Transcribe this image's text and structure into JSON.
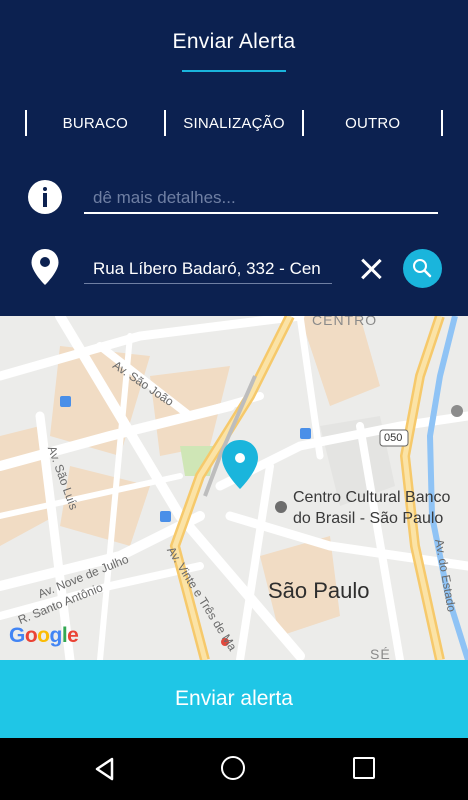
{
  "header": {
    "title": "Enviar Alerta"
  },
  "categories": [
    {
      "label": "BURACO"
    },
    {
      "label": "SINALIZAÇÃO"
    },
    {
      "label": "OUTRO"
    }
  ],
  "details": {
    "placeholder": "dê mais detalhes...",
    "value": ""
  },
  "address": {
    "value": "Rua Líbero Badaró, 332 - Cen"
  },
  "icons": {
    "info": "info-icon",
    "location": "location-pin-icon",
    "clear": "close-icon",
    "search": "search-icon",
    "map_marker": "map-marker-icon"
  },
  "map": {
    "area_label": "CENTRO",
    "streets": [
      "Av. São João",
      "Av. São Luís",
      "Av. Nove de Julho",
      "R. Santo Antônio",
      "Av. Vinte e Três de Ma",
      "Av. do Estado"
    ],
    "poi_line1": "Centro Cultural Banco",
    "poi_line2": "do Brasil - São Paulo",
    "city": "São Paulo",
    "highway_badge": "050",
    "area_bottom": "SÉ",
    "attribution": [
      "G",
      "o",
      "o",
      "g",
      "l",
      "e"
    ]
  },
  "footer": {
    "send_label": "Enviar alerta"
  },
  "colors": {
    "header_bg": "#0c2150",
    "accent": "#1ab5dc",
    "button_bg": "#1fc6e6"
  }
}
